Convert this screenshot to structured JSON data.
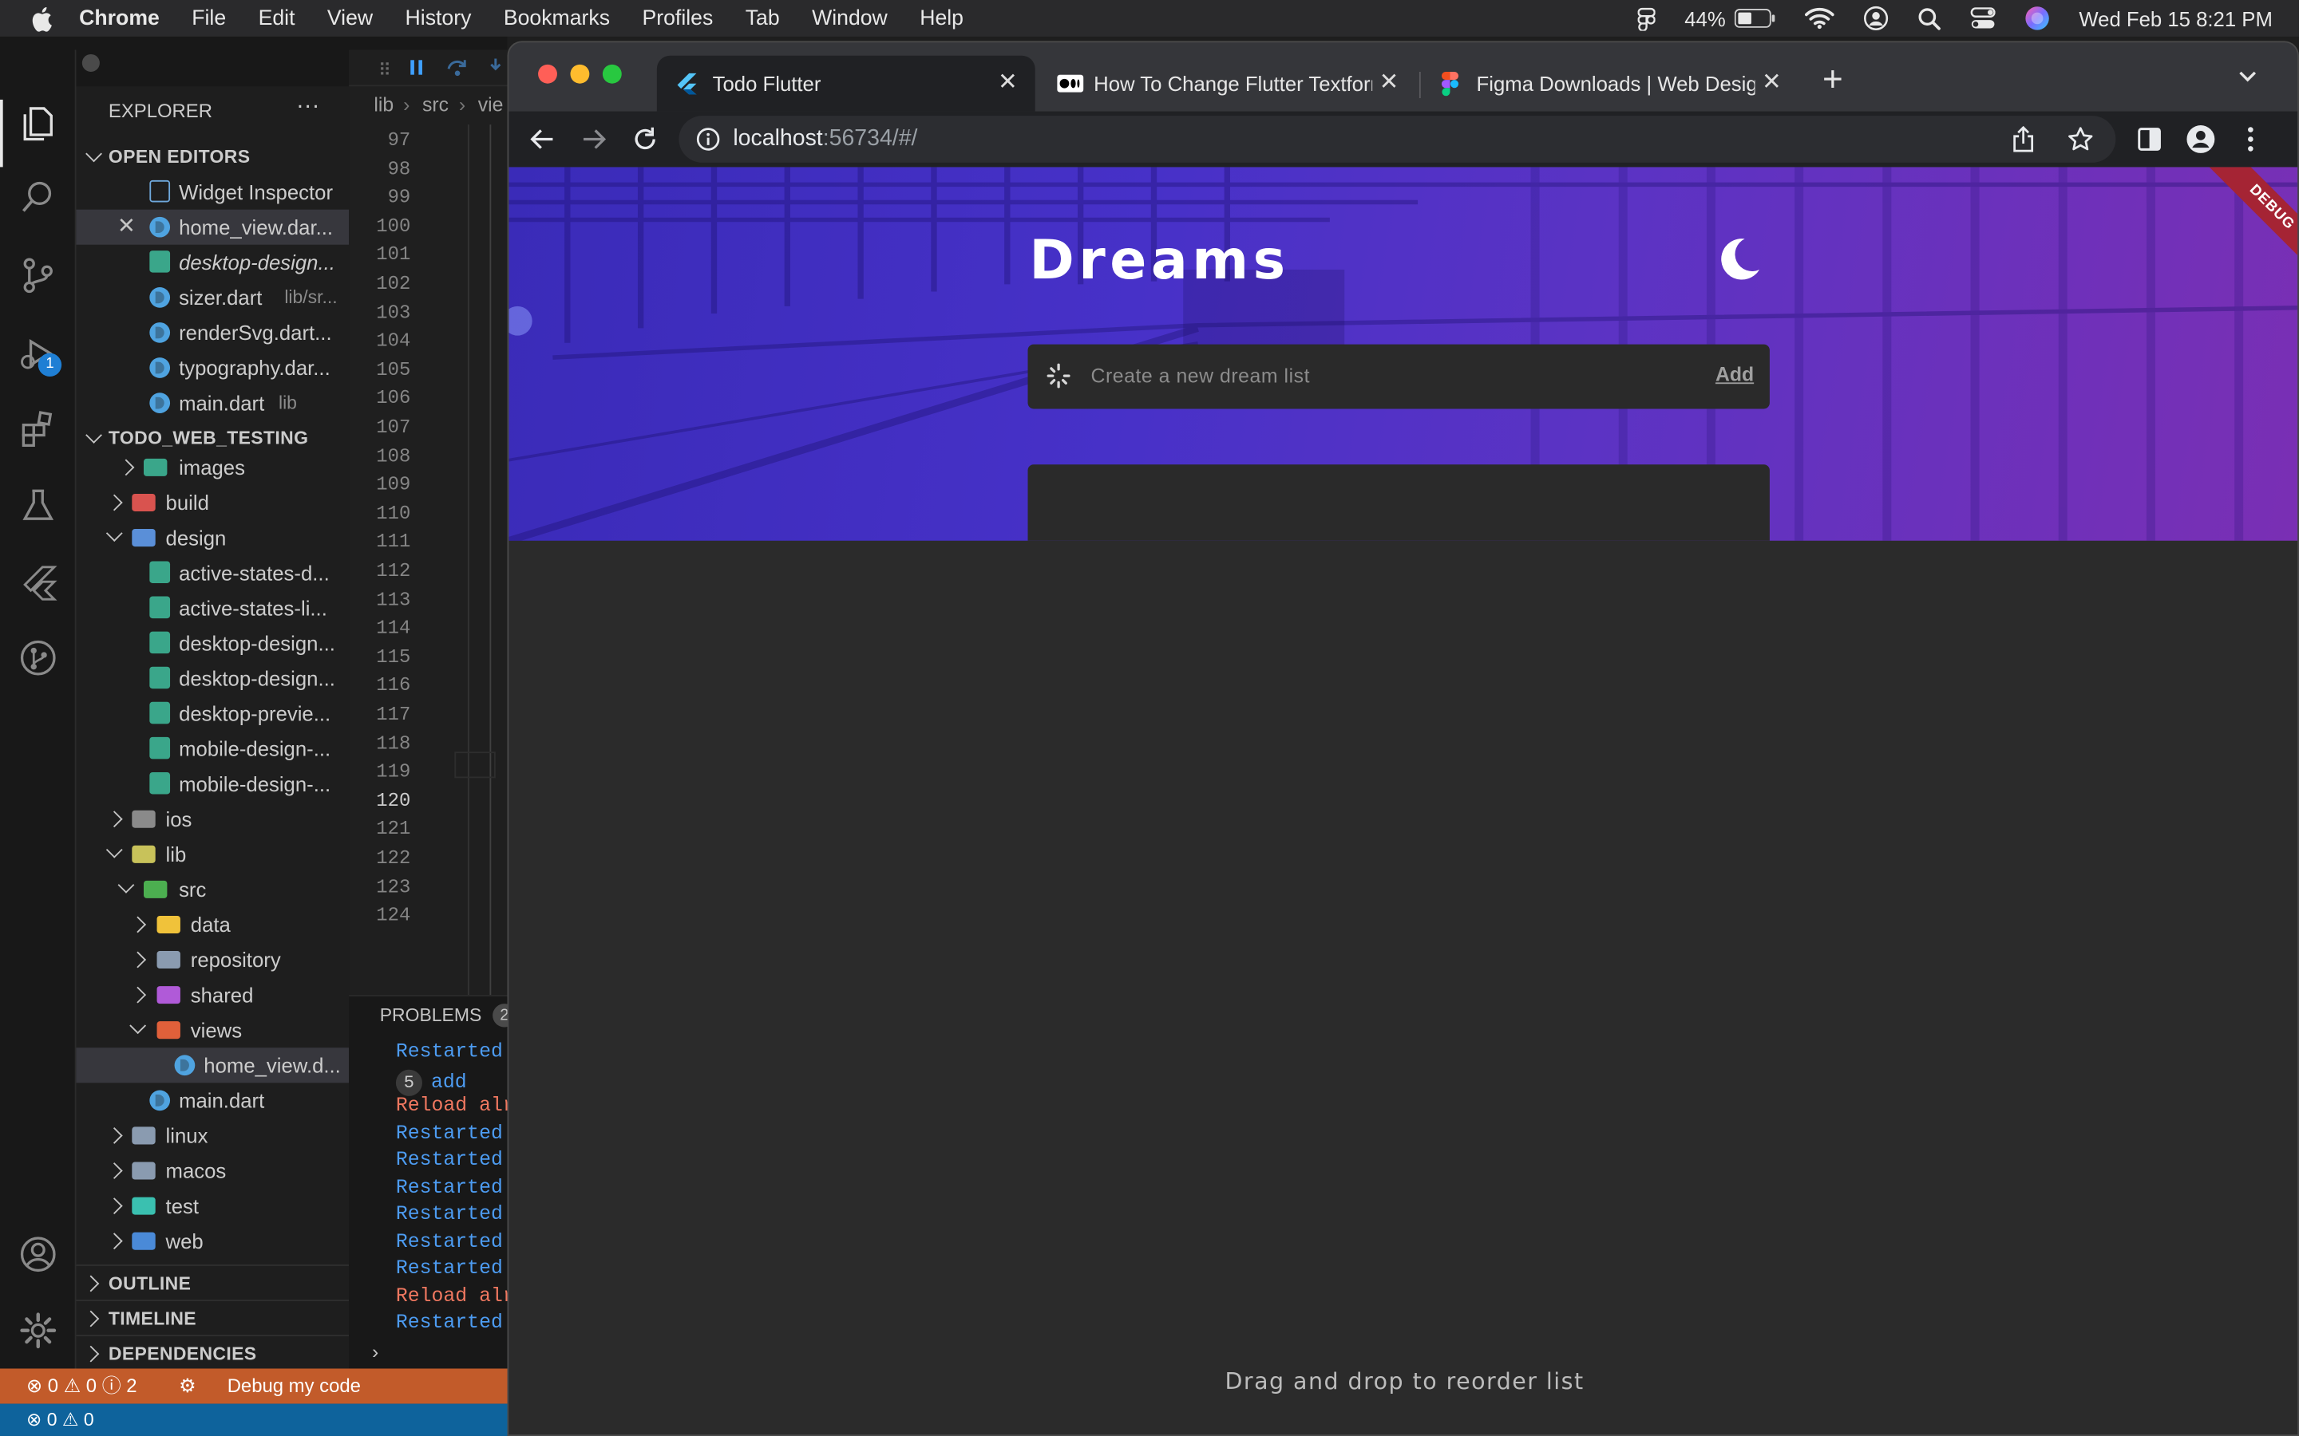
{
  "menubar": {
    "app": "Chrome",
    "items": [
      "File",
      "Edit",
      "View",
      "History",
      "Bookmarks",
      "Profiles",
      "Tab",
      "Window",
      "Help"
    ],
    "battery": "44%",
    "datetime": "Wed Feb 15  8:21 PM"
  },
  "vscode": {
    "explorer_title": "EXPLORER",
    "more_label": "···",
    "open_editors_title": "OPEN EDITORS",
    "open_editors": [
      {
        "name": "Widget Inspector",
        "hint": ""
      },
      {
        "name": "home_view.dar...",
        "hint": ""
      },
      {
        "name": "desktop-design...",
        "hint": ""
      },
      {
        "name": "sizer.dart",
        "hint": "lib/sr..."
      },
      {
        "name": "renderSvg.dart...",
        "hint": ""
      },
      {
        "name": "typography.dar...",
        "hint": ""
      },
      {
        "name": "main.dart",
        "hint": "lib"
      }
    ],
    "project_title": "TODO_WEB_TESTING",
    "tree": [
      "images",
      "build",
      "design",
      "active-states-d...",
      "active-states-li...",
      "desktop-design...",
      "desktop-design...",
      "desktop-previe...",
      "mobile-design-...",
      "mobile-design-...",
      "ios",
      "lib",
      "src",
      "data",
      "repository",
      "shared",
      "views",
      "home_view.d...",
      "main.dart",
      "linux",
      "macos",
      "test",
      "web"
    ],
    "outline_title": "OUTLINE",
    "timeline_title": "TIMELINE",
    "dependencies_title": "DEPENDENCIES",
    "breadcrumb": [
      "lib",
      "src",
      "vie"
    ],
    "line_numbers": [
      "97",
      "98",
      "99",
      "100",
      "101",
      "102",
      "103",
      "104",
      "105",
      "106",
      "107",
      "108",
      "109",
      "110",
      "111",
      "112",
      "113",
      "114",
      "115",
      "116",
      "117",
      "118",
      "119",
      "120",
      "121",
      "122",
      "123",
      "124"
    ],
    "panel_tab": "PROBLEMS",
    "panel_badge": "2",
    "debug_badge": "1",
    "console_lines": [
      {
        "text": "Restarted",
        "color": "#4d9cf2"
      },
      {
        "text": "add",
        "color": "#4d9cf2",
        "badge": "5"
      },
      {
        "text": "Reload alr",
        "color": "#f07860"
      },
      {
        "text": "Restarted",
        "color": "#4d9cf2"
      },
      {
        "text": "Restarted",
        "color": "#4d9cf2"
      },
      {
        "text": "Restarted",
        "color": "#4d9cf2"
      },
      {
        "text": "Restarted",
        "color": "#4d9cf2"
      },
      {
        "text": "Restarted",
        "color": "#4d9cf2"
      },
      {
        "text": "Restarted",
        "color": "#4d9cf2"
      },
      {
        "text": "Reload alr",
        "color": "#f07860"
      },
      {
        "text": "Restarted",
        "color": "#4d9cf2"
      }
    ],
    "status": {
      "errors": "0",
      "warnings": "0",
      "infos": "2",
      "debug": "Debug my code",
      "bottom_errors": "0",
      "bottom_warnings": "0"
    }
  },
  "chrome": {
    "tabs": [
      {
        "title": "Todo Flutter",
        "active": true
      },
      {
        "title": "How To Change Flutter Textform",
        "active": false
      },
      {
        "title": "Figma Downloads | Web Design",
        "active": false
      }
    ],
    "url_host": "localhost",
    "url_rest": ":56734/#/"
  },
  "app": {
    "title": "Dreams",
    "debug_banner": "DEBUG",
    "input_placeholder": "Create a new dream list",
    "add_label": "Add",
    "footer": "Drag and drop to reorder list"
  },
  "colors": {
    "hero_start": "#3a2bb8",
    "hero_end": "#7a2fb4",
    "statusbar": "#c25b2a",
    "page_bg": "#2b2b2b"
  }
}
